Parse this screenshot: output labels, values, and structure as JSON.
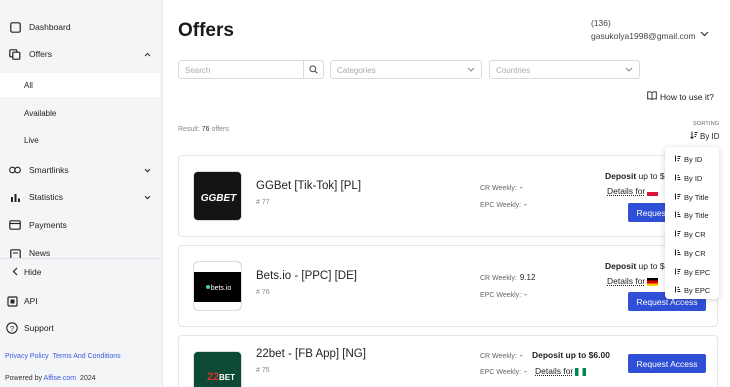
{
  "sidebar": {
    "items": [
      {
        "label": "Dashboard",
        "icon": "dashboard-icon"
      },
      {
        "label": "Offers",
        "icon": "offers-icon",
        "chevron": "up"
      },
      {
        "label": "Smartlinks",
        "icon": "link-icon",
        "chevron": "down"
      },
      {
        "label": "Statistics",
        "icon": "chart-icon",
        "chevron": "down"
      },
      {
        "label": "Payments",
        "icon": "wallet-icon"
      },
      {
        "label": "News",
        "icon": "news-icon"
      }
    ],
    "sub_items": [
      {
        "label": "All",
        "active": true
      },
      {
        "label": "Available",
        "active": false
      },
      {
        "label": "Live",
        "active": false
      }
    ],
    "hide_label": "Hide",
    "api_label": "API",
    "support_label": "Support",
    "footer": {
      "privacy": "Privacy Policy",
      "terms": "Terms And Conditions",
      "powered_prefix": "Powered by",
      "powered_link": "Affise.com",
      "year": "2024"
    }
  },
  "header": {
    "title": "Offers",
    "user_count": "(136)",
    "user_email": "gasukolya1998@gmail.com"
  },
  "filters": {
    "search_placeholder": "Search",
    "categories_placeholder": "Categories",
    "countries_placeholder": "Countries"
  },
  "help_link": "How to use it?",
  "result": {
    "prefix": "Result:",
    "count": "76",
    "suffix": "offers"
  },
  "sorting": {
    "label": "SORTING",
    "current": "By ID",
    "options": [
      "By ID",
      "By ID",
      "By Title",
      "By Title",
      "By CR",
      "By CR",
      "By EPC",
      "By EPC"
    ]
  },
  "offers": [
    {
      "name": "GGBet [Tik-Tok] [PL]",
      "id": "# 77",
      "cr_label": "CR Weekly:",
      "cr_value": "-",
      "epc_label": "EPC Weekly:",
      "epc_value": "-",
      "payout_label": "Deposit",
      "payout_text": "up to $",
      "details": "Details for",
      "button": "Request Access",
      "logo_text": "GGBET"
    },
    {
      "name": "Bets.io - [PPC] [DE]",
      "id": "# 76",
      "cr_label": "CR Weekly:",
      "cr_value": "9.12",
      "epc_label": "EPC Weekly:",
      "epc_value": "-",
      "payout_label": "Deposit",
      "payout_text": "up to $",
      "details": "Details for",
      "button": "Request Access",
      "logo_text": "bets.io"
    },
    {
      "name": "22bet - [FB App] [NG]",
      "id": "# 75",
      "cr_label": "CR Weekly:",
      "cr_value": "-",
      "epc_label": "EPC Weekly:",
      "epc_value": "-",
      "payout_label": "Deposit",
      "payout_text": "up to $6.00",
      "details": "Details for",
      "button": "Request Access",
      "logo_text": "BET"
    }
  ],
  "colors": {
    "accent": "#2f4fd6",
    "sidebar_bg": "#f4f5f7"
  }
}
